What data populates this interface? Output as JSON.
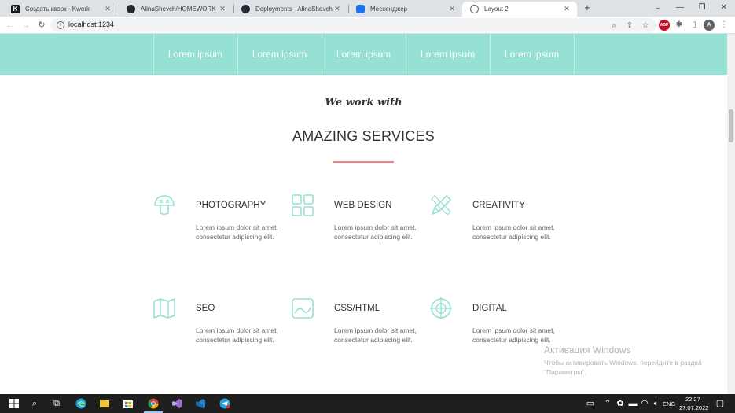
{
  "browser": {
    "tabs": [
      {
        "title": "Создать кворк - Kwork",
        "favicon": "kwork-icon",
        "active": false
      },
      {
        "title": "AlinaShevch/HOMEWORK",
        "favicon": "github-icon",
        "active": false
      },
      {
        "title": "Deployments - AlinaShevch/mod",
        "favicon": "github-icon",
        "active": false
      },
      {
        "title": "Мессенджер",
        "favicon": "messenger-icon",
        "active": false
      },
      {
        "title": "Layout 2",
        "favicon": "globe-icon",
        "active": true
      }
    ],
    "url": "localhost:1234",
    "profile_initial": "A",
    "adblock_label": "ABP"
  },
  "nav_band": {
    "items": [
      "Lorem ipsum",
      "Lorem ipsum",
      "Lorem ipsum",
      "Lorem ipsum",
      "Lorem ipsum"
    ],
    "color": "#95e1d3"
  },
  "section": {
    "subtitle": "We work with",
    "title": "AMAZING SERVICES",
    "accent_color": "#f38181",
    "icon_color": "#95e1d3"
  },
  "services": [
    {
      "title": "PHOTOGRAPHY",
      "icon": "mushroom-icon",
      "desc1": "Lorem ipsum dolor sit amet,",
      "desc2": "consectetur adipiscing elit."
    },
    {
      "title": "WEB DESIGN",
      "icon": "grid-icon",
      "desc1": "Lorem ipsum dolor sit amet,",
      "desc2": "consectetur adipiscing elit."
    },
    {
      "title": "CREATIVITY",
      "icon": "pencil-ruler-icon",
      "desc1": "Lorem ipsum dolor sit amet,",
      "desc2": "consectetur adipiscing elit."
    },
    {
      "title": "SEO",
      "icon": "map-icon",
      "desc1": "Lorem ipsum dolor sit amet,",
      "desc2": "consectetur adipiscing elit."
    },
    {
      "title": "CSS/HTML",
      "icon": "image-icon",
      "desc1": "Lorem ipsum dolor sit amet,",
      "desc2": "consectetur adipiscing elit."
    },
    {
      "title": "DIGITAL",
      "icon": "crosshair-icon",
      "desc1": "Lorem ipsum dolor sit amet,",
      "desc2": "consectetur adipiscing elit."
    }
  ],
  "watermark": {
    "title": "Активация Windows",
    "subtitle": "Чтобы активировать Windows, перейдите в раздел \"Параметры\"."
  },
  "taskbar": {
    "language": "ENG",
    "time": "22:27",
    "date": "27.07.2022"
  }
}
